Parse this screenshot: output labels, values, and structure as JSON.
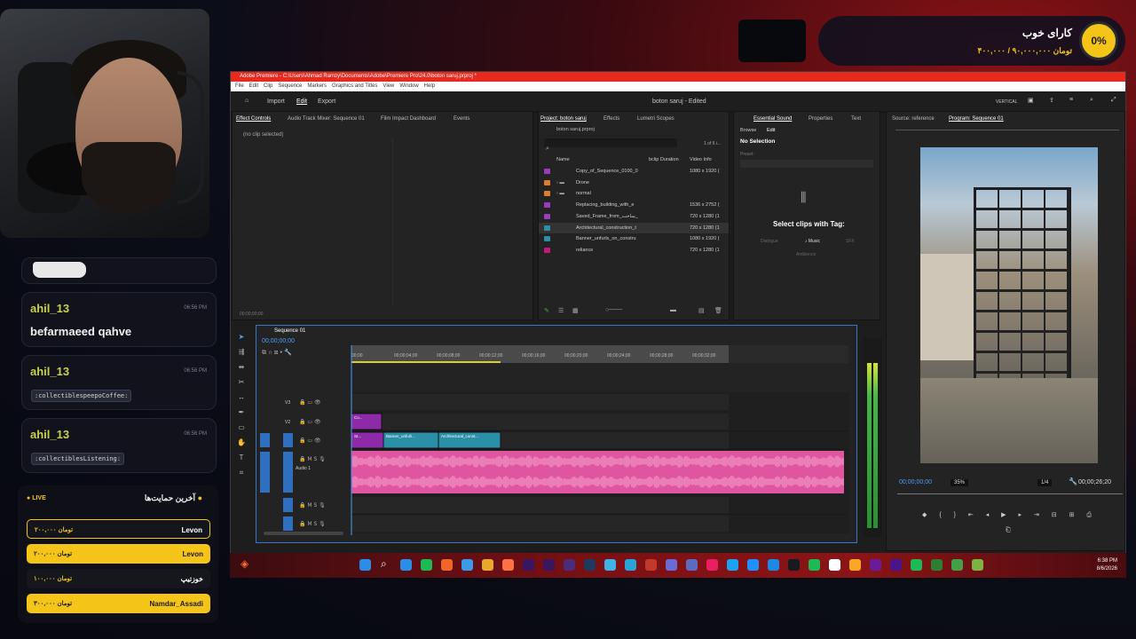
{
  "donation": {
    "goal_title": "کارای خوب",
    "goal_progress": "۴۰۰,۰۰۰ / ۹۰,۰۰۰,۰۰۰ تومان",
    "percent": "0%"
  },
  "chat": [
    {
      "user": "ahil_13",
      "time": "06:56 PM",
      "message": "befarmaeed qahve",
      "emote": ""
    },
    {
      "user": "ahil_13",
      "time": "06:56 PM",
      "message": "",
      "emote": ":collectiblespeepoCoffee:"
    },
    {
      "user": "ahil_13",
      "time": "06:56 PM",
      "message": "",
      "emote": ":collectiblesListening:"
    }
  ],
  "supporters": {
    "title": "آخرین حمایت‌ها",
    "live": "LIVE",
    "items": [
      {
        "name": "Levon",
        "amount": "۲۰۰,۰۰۰ تومان",
        "style": "outline"
      },
      {
        "name": "Levon",
        "amount": "۲۰۰,۰۰۰ تومان",
        "style": "yellow"
      },
      {
        "name": "خوزتیپ",
        "amount": "۱۰۰,۰۰۰ تومان",
        "style": "dark"
      },
      {
        "name": "Namdar_Assadi",
        "amount": "۳۰۰,۰۰۰ تومان",
        "style": "yellow"
      }
    ]
  },
  "premiere": {
    "title": "Adobe Premiere - C:\\Users\\Ahmad Ramzy\\Documents\\Adobe\\Premiere Pro\\24.0\\boton saruj.prproj *",
    "menu": [
      "File",
      "Edit",
      "Clip",
      "Sequence",
      "Markers",
      "Graphics and Titles",
      "View",
      "Window",
      "Help"
    ],
    "header": {
      "import": "Import",
      "edit": "Edit",
      "export": "Export",
      "project_name": "boton saruj - Edited",
      "vertical": "VERTICAL"
    },
    "effect_controls": {
      "tabs": [
        "Effect Controls",
        "Audio Track Mixer: Sequence 01",
        "Film Impact Dashboard",
        "Events"
      ],
      "no_clip": "(no clip selected)",
      "timecode": "00;00;00;00"
    },
    "project": {
      "tabs": [
        "Project: boton saruj",
        "Effects",
        "Lumetri Scopes"
      ],
      "file": "boton saruj.prproj",
      "count": "1 of 6 i...",
      "columns": [
        "Name",
        "bclip Duration",
        "Video Info"
      ],
      "items": [
        {
          "name": "Copy_of_Sequence_0100_0",
          "info": "1080 x 1920 (",
          "color": "#9b3bbd",
          "folder": false
        },
        {
          "name": "Drone",
          "info": "",
          "color": "#e07b28",
          "folder": true
        },
        {
          "name": "normal",
          "info": "",
          "color": "#e07b28",
          "folder": true
        },
        {
          "name": "Replacing_building_with_e",
          "info": "1536 x 2752 (",
          "color": "#9b3bbd",
          "folder": false
        },
        {
          "name": "Saved_Frame_from_ساخت_",
          "info": "720 x 1280 (1",
          "color": "#9b3bbd",
          "folder": false
        },
        {
          "name": "Architectural_construction_t",
          "info": "720 x 1280 (1",
          "color": "#2b8fa8",
          "folder": false
        },
        {
          "name": "Banner_unfurls_on_constru",
          "info": "1080 x 1920 (",
          "color": "#2b8fa8",
          "folder": false
        },
        {
          "name": "reliance",
          "info": "720 x 1280 (1",
          "color": "#c2187a",
          "folder": false
        }
      ]
    },
    "essential_sound": {
      "tabs": [
        "Essential Sound",
        "Properties",
        "Text"
      ],
      "browse": "Browse",
      "edit": "Edit",
      "no_selection": "No Selection",
      "preset": "Preset:",
      "select_text": "Select clips with Tag:",
      "dialogue": "Dialogue",
      "music": "Music",
      "sfx": "SFX",
      "ambience": "Ambience"
    },
    "monitor": {
      "source": "Source: reference",
      "program": "Program: Sequence 01",
      "timecode": "00;00;00;00",
      "zoom": "35%",
      "quality": "1/4",
      "duration": "00;00;26;20"
    },
    "timeline": {
      "sequence": "Sequence 01",
      "timecode": "00;00;00;00",
      "ruler": [
        "00;00",
        "00;00;04;00",
        "00;00;08;00",
        "00;00;12;00",
        "00;00;16;00",
        "00;00;20;00",
        "00;00;24;00",
        "00;00;28;00",
        "00;00;32;00"
      ],
      "tracks": [
        "V3",
        "V2",
        "V1",
        "A1",
        "A2",
        "A3"
      ],
      "audio1": "Audio 1",
      "clips": [
        "Co...",
        "St...",
        "Banner_unfurli...",
        "Architectural_const..."
      ]
    },
    "taskbar": {
      "time": "6:38 PM",
      "date": "8/6/2026"
    }
  },
  "colors": {
    "accent": "#f4c419",
    "premiere_red": "#e62a20",
    "clip_purple": "#8e2aa8",
    "clip_teal": "#2b8fa8",
    "audio_pink": "#e0559f"
  }
}
